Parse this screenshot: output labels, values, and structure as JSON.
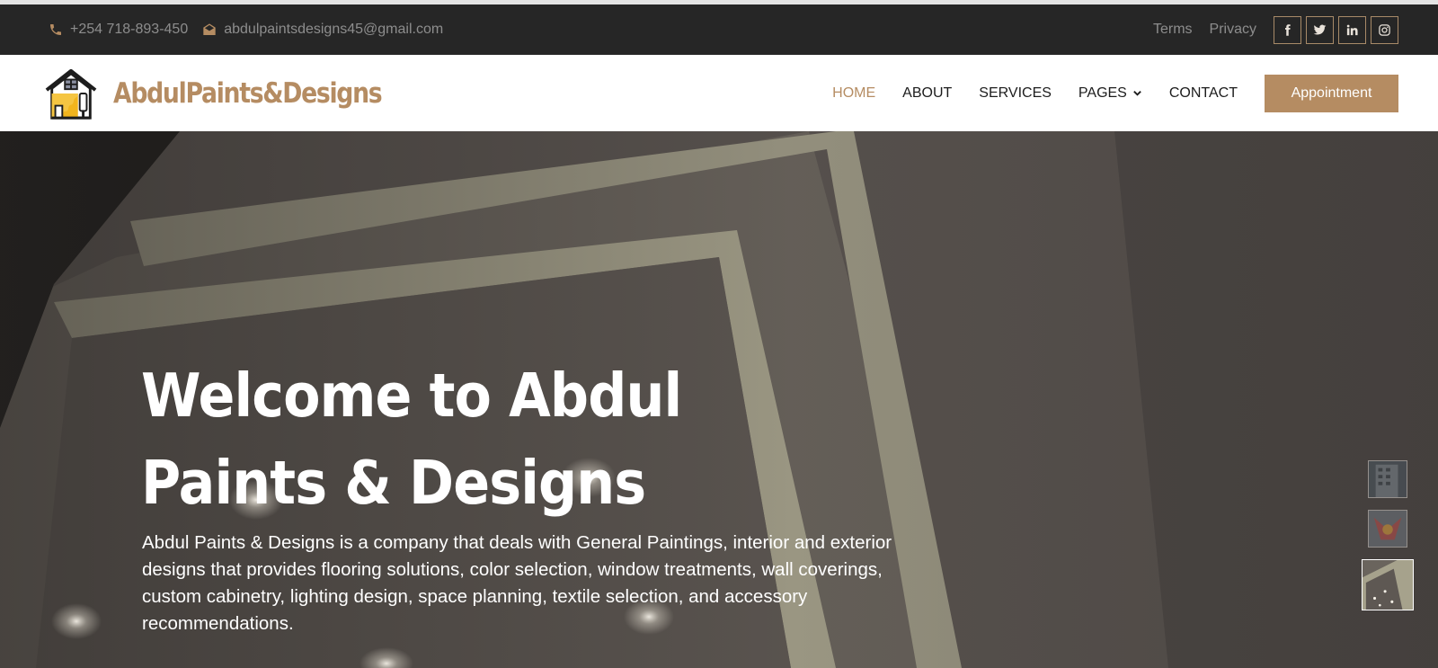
{
  "topbar": {
    "phone": "+254 718-893-450",
    "email": "abdulpaintsdesigns45@gmail.com",
    "links": [
      "Terms",
      "Privacy"
    ],
    "socials": [
      "facebook-icon",
      "twitter-icon",
      "linkedin-icon",
      "instagram-icon"
    ]
  },
  "brand": {
    "name": "AbdulPaints&Designs"
  },
  "nav": {
    "items": [
      {
        "label": "HOME",
        "active": true
      },
      {
        "label": "ABOUT"
      },
      {
        "label": "SERVICES"
      },
      {
        "label": "PAGES"
      },
      {
        "label": "CONTACT"
      }
    ],
    "cta": "Appointment"
  },
  "hero": {
    "title": "Welcome to Abdul Paints & Designs",
    "description": "Abdul Paints & Designs is a company that deals with General Paintings, interior and exterior designs that provides flooring solutions, color selection, window treatments, wall coverings, custom cabinetry, lighting design, space planning, textile selection, and accessory recommendations."
  },
  "slider": {
    "slides": 3,
    "active_slide": 3
  },
  "colors": {
    "accent": "#b58c62",
    "topbar_bg": "#262626",
    "text_dark": "#1c1c1c"
  }
}
